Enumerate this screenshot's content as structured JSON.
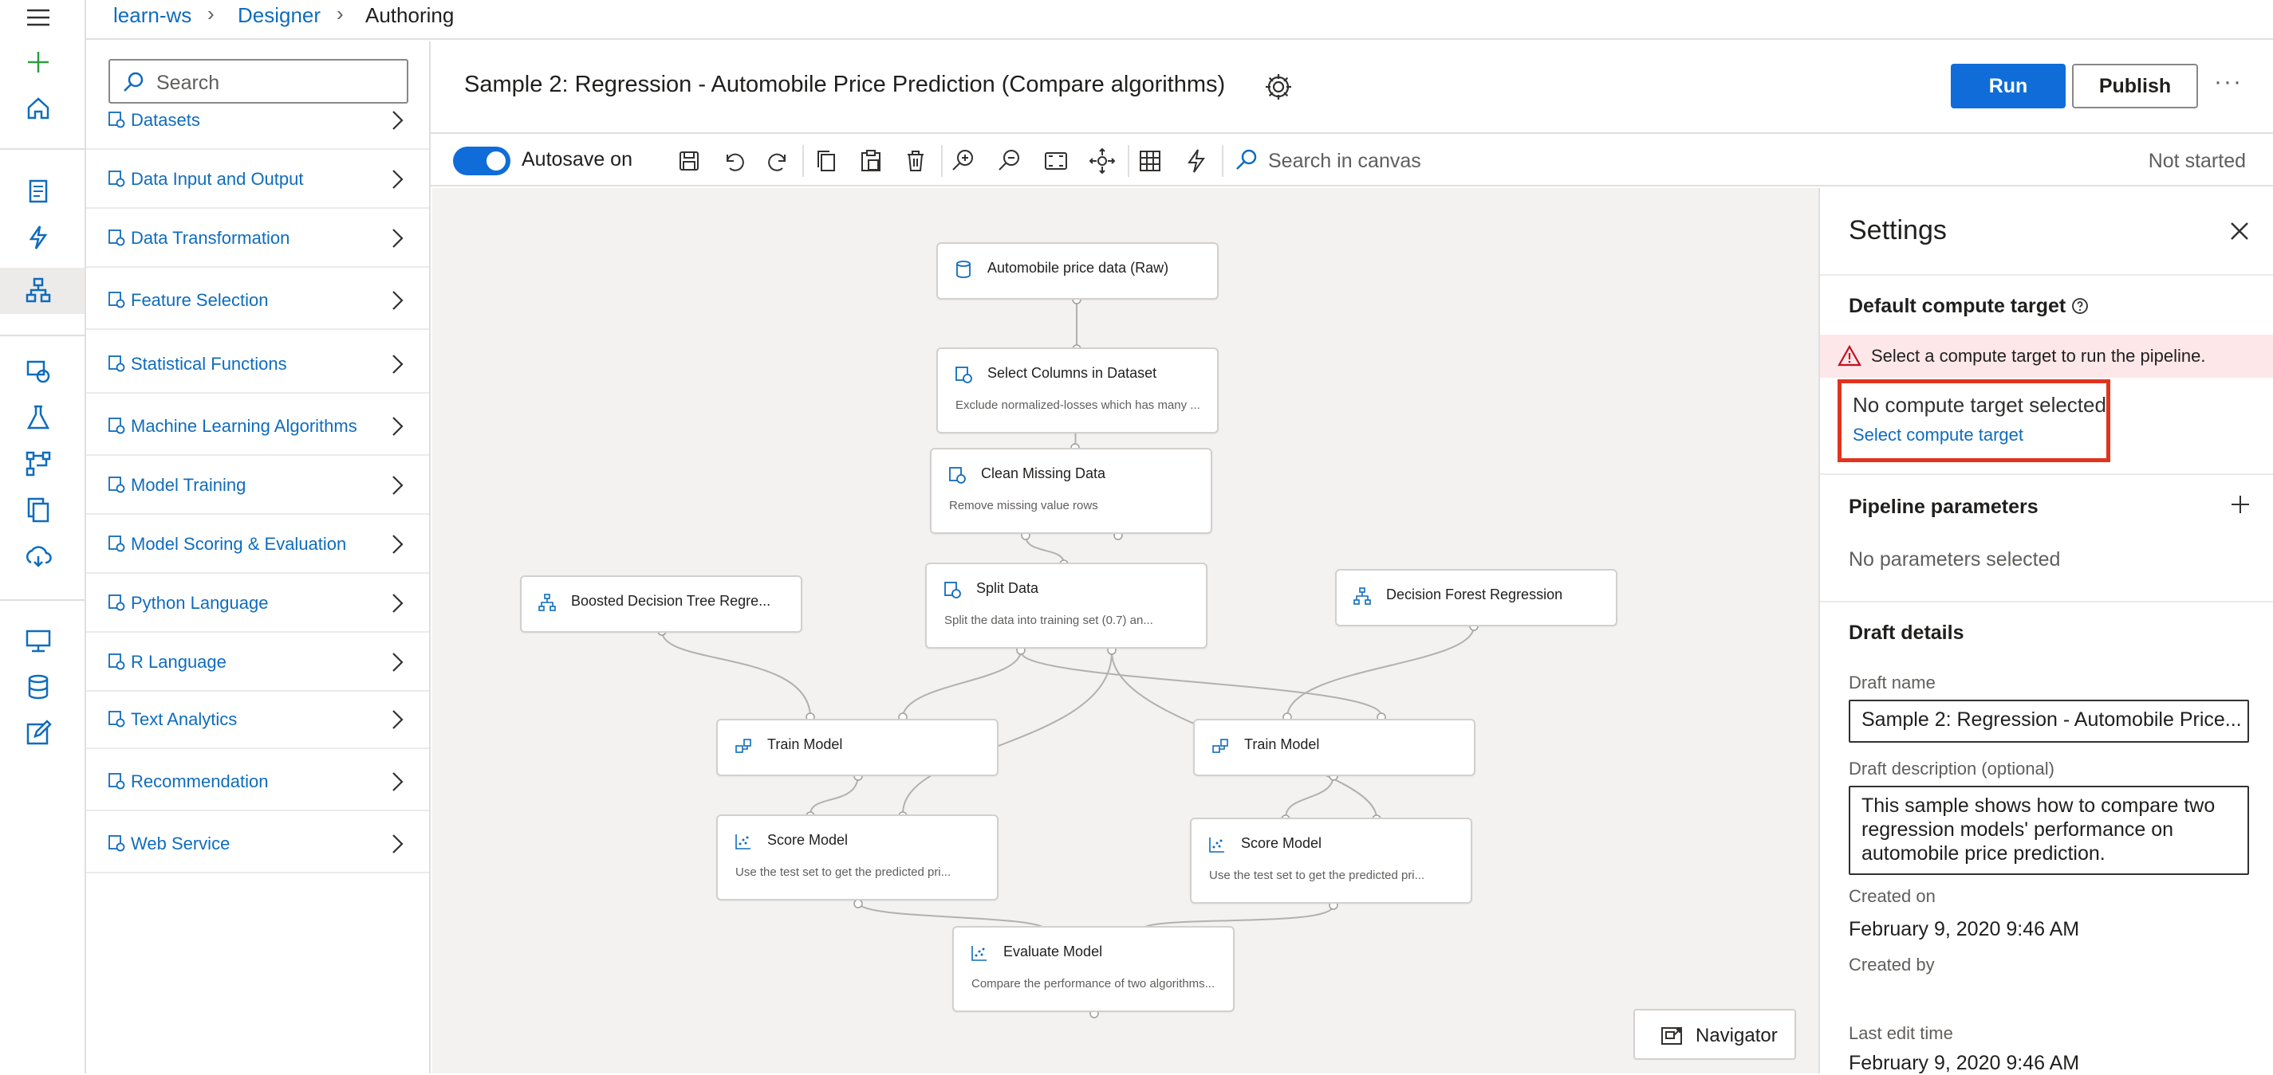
{
  "breadcrumb": {
    "workspace": "learn-ws",
    "designer": "Designer",
    "current": "Authoring"
  },
  "palette": {
    "search_placeholder": "Search",
    "categories": [
      {
        "label": "Datasets",
        "icon": "datasets-icon"
      },
      {
        "label": "Data Input and Output",
        "icon": "data-io-icon"
      },
      {
        "label": "Data Transformation",
        "icon": "data-transformation-icon"
      },
      {
        "label": "Feature Selection",
        "icon": "feature-selection-icon"
      },
      {
        "label": "Statistical Functions",
        "icon": "statistical-functions-icon"
      },
      {
        "label": "Machine Learning Algorithms",
        "icon": "ml-algorithms-icon"
      },
      {
        "label": "Model Training",
        "icon": "model-training-icon"
      },
      {
        "label": "Model Scoring & Evaluation",
        "icon": "model-scoring-icon"
      },
      {
        "label": "Python Language",
        "icon": "python-icon"
      },
      {
        "label": "R Language",
        "icon": "r-icon"
      },
      {
        "label": "Text Analytics",
        "icon": "text-analytics-icon"
      },
      {
        "label": "Recommendation",
        "icon": "recommendation-icon"
      },
      {
        "label": "Web Service",
        "icon": "web-service-icon"
      }
    ]
  },
  "header": {
    "title": "Sample 2: Regression - Automobile Price Prediction (Compare algorithms)",
    "run_label": "Run",
    "publish_label": "Publish",
    "more_label": "···"
  },
  "toolbar": {
    "autosave_label": "Autosave on",
    "autosave_on": true,
    "search_placeholder": "Search in canvas",
    "status": "Not started"
  },
  "canvas": {
    "nodes": {
      "raw_data": {
        "title": "Automobile price data (Raw)",
        "subtitle": ""
      },
      "select_columns": {
        "title": "Select Columns in Dataset",
        "subtitle": "Exclude normalized-losses which has many ..."
      },
      "clean_missing": {
        "title": "Clean Missing Data",
        "subtitle": "Remove missing value rows"
      },
      "split_data": {
        "title": "Split Data",
        "subtitle": "Split the data into training set (0.7) an..."
      },
      "boosted_tree": {
        "title": "Boosted Decision Tree Regre...",
        "subtitle": ""
      },
      "decision_forest": {
        "title": "Decision Forest Regression",
        "subtitle": ""
      },
      "train_left": {
        "title": "Train Model",
        "subtitle": ""
      },
      "train_right": {
        "title": "Train Model",
        "subtitle": ""
      },
      "score_left": {
        "title": "Score Model",
        "subtitle": "Use the test set to get the predicted pri..."
      },
      "score_right": {
        "title": "Score Model",
        "subtitle": "Use the test set to get the predicted pri..."
      },
      "evaluate": {
        "title": "Evaluate Model",
        "subtitle": "Compare the performance of two algorithms..."
      }
    },
    "navigator_label": "Navigator"
  },
  "settings": {
    "title": "Settings",
    "compute_section": "Default compute target",
    "error_message": "Select a compute target to run the pipeline.",
    "no_compute": "No compute target selected",
    "select_compute_link": "Select compute target",
    "params_section": "Pipeline parameters",
    "no_params": "No parameters selected",
    "draft_section": "Draft details",
    "draft_name_label": "Draft name",
    "draft_name_value": "Sample 2: Regression - Automobile Price...",
    "draft_desc_label": "Draft description (optional)",
    "draft_desc_value": "This sample shows how to compare two regression models' performance on automobile price prediction.",
    "created_on_label": "Created on",
    "created_on_value": "February 9, 2020 9:46 AM",
    "created_by_label": "Created by",
    "last_edit_label": "Last edit time",
    "last_edit_value": "February 9, 2020 9:46 AM"
  },
  "colors": {
    "accent": "#0f6cd8",
    "link": "#0f6cbd",
    "error": "#e0341e",
    "error_bg": "#fde7e9"
  }
}
